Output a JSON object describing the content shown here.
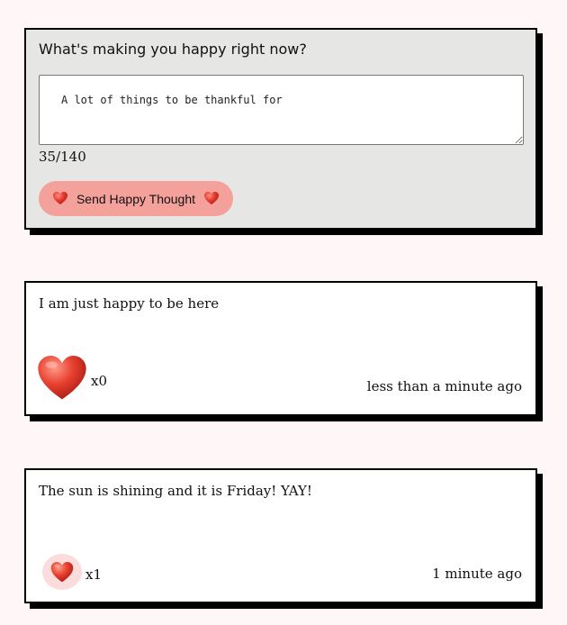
{
  "form": {
    "question": "What's making you happy right now?",
    "message": "A lot of things to be thankful for",
    "counter": "35/140",
    "send_label": "Send Happy Thought"
  },
  "thoughts": [
    {
      "message": "I am just happy to be here",
      "likes": "x0",
      "time": "less than a minute ago"
    },
    {
      "message": "The sun is shining and it is Friday! YAY!",
      "likes": "x1",
      "time": "1 minute ago"
    }
  ],
  "icons": {
    "heart": "heart-icon"
  },
  "colors": {
    "background": "#fff7f7",
    "form_background": "#e6e6e4",
    "button": "#f4a19b",
    "liked_bubble": "#fadcdc",
    "heart": "#e53b2e"
  }
}
